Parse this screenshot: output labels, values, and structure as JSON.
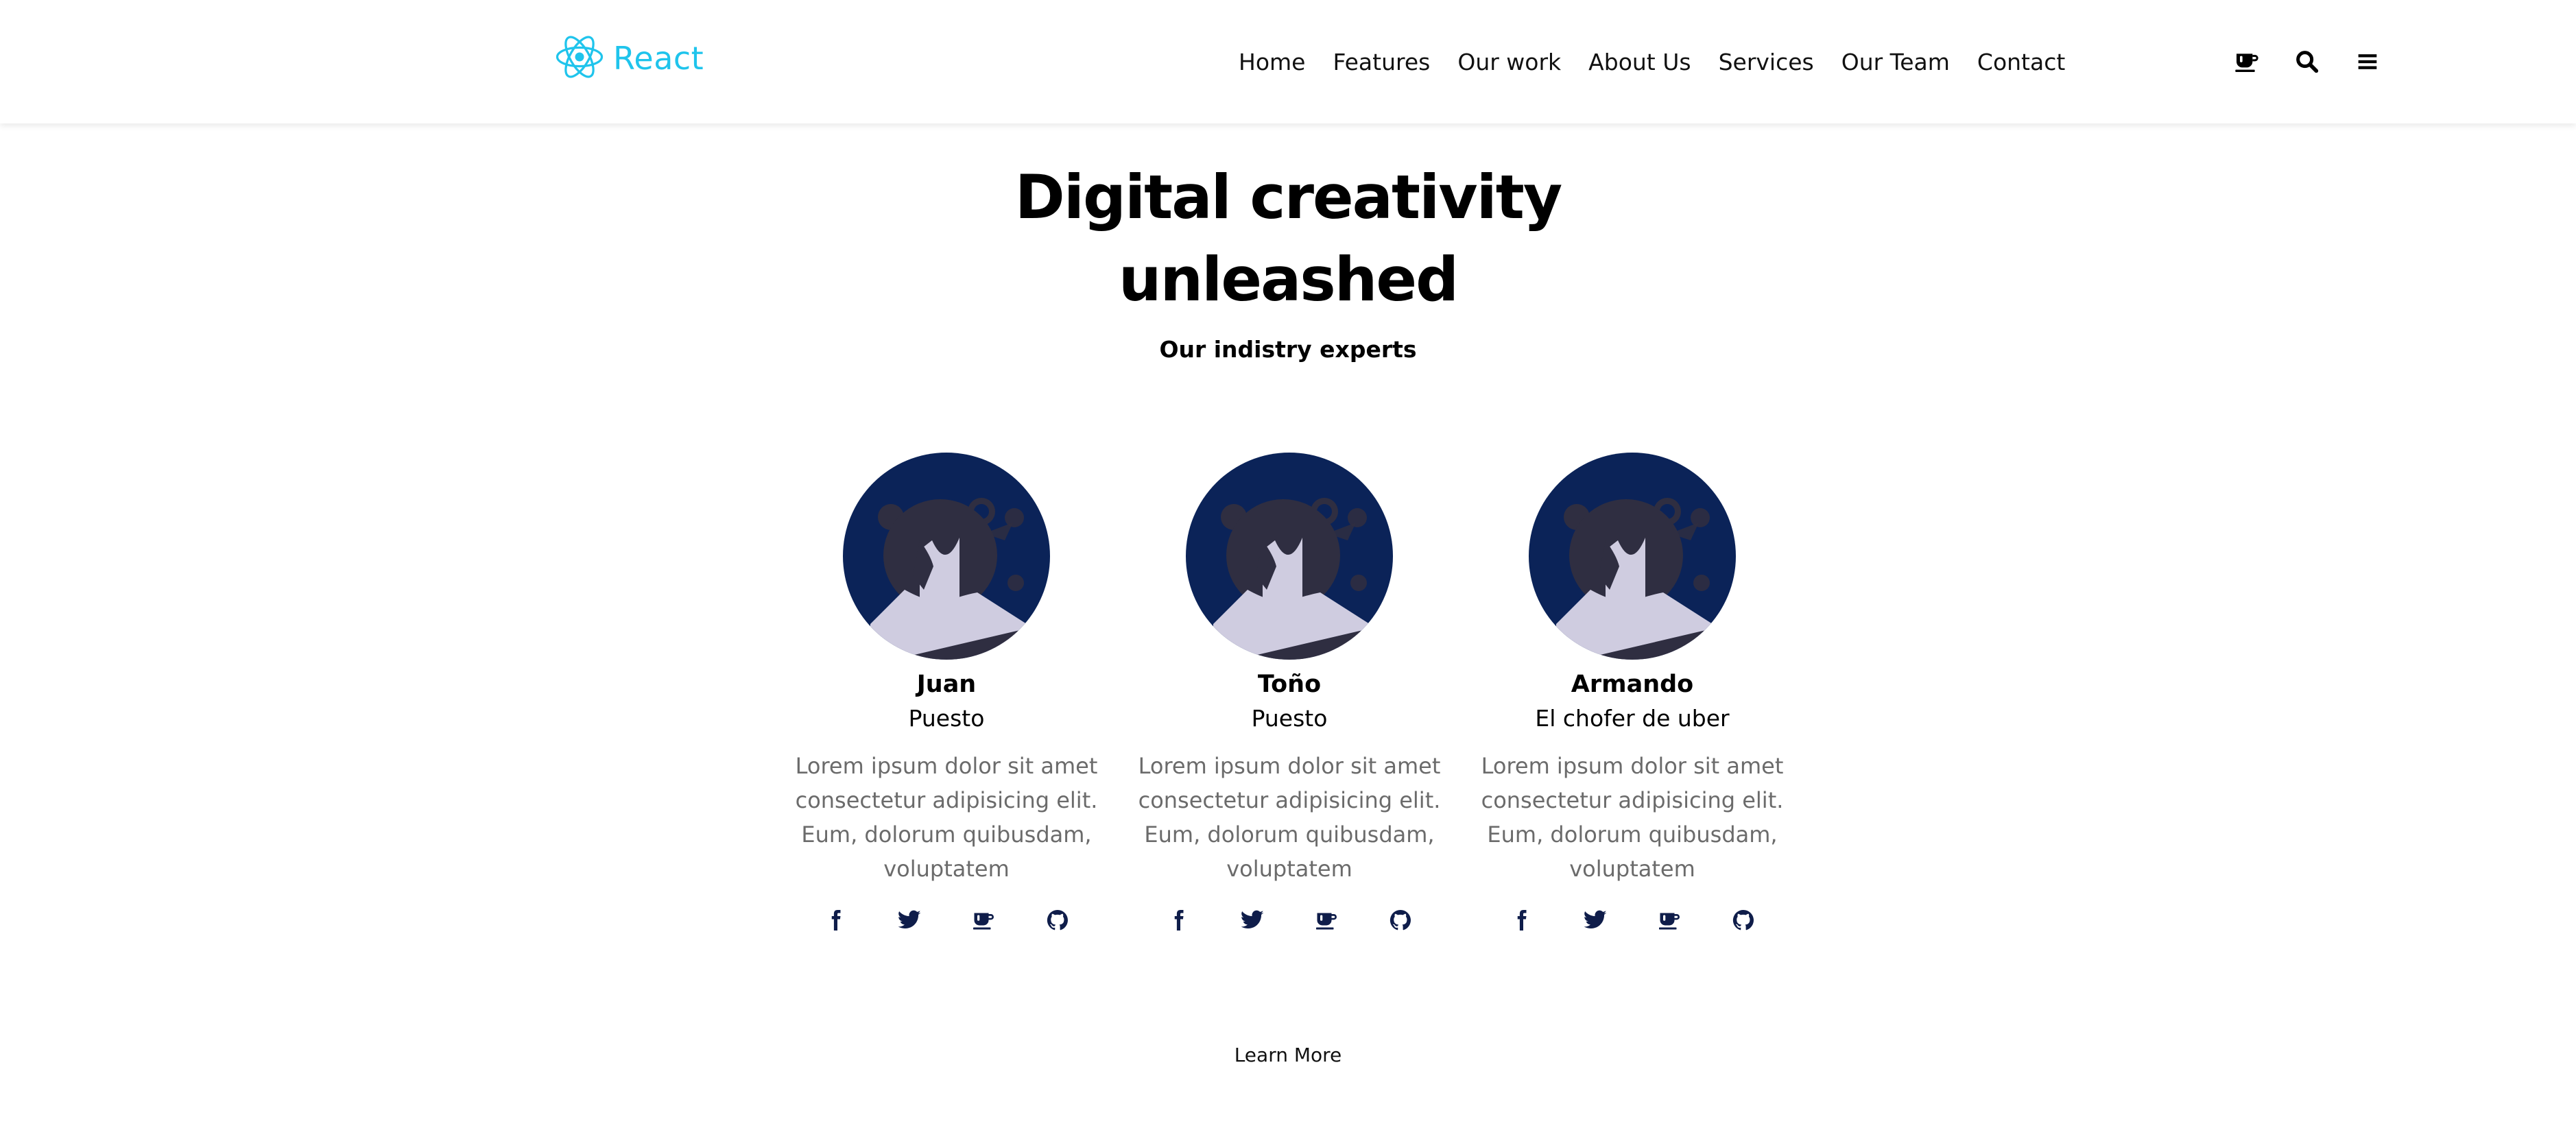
{
  "brand": {
    "name": "React",
    "color": "#1fc4ec",
    "icon": "react-logo-icon"
  },
  "nav": {
    "items": [
      "Home",
      "Features",
      "Our work",
      "About Us",
      "Services",
      "Our Team",
      "Contact"
    ]
  },
  "toolbar": {
    "icons": [
      "coffee-icon",
      "search-icon",
      "menu-icon"
    ]
  },
  "hero": {
    "title_line1": "Digital creativity",
    "title_line2": "unleashed",
    "subtitle": "Our indistry experts"
  },
  "team": [
    {
      "name": "Juan",
      "role": "Puesto",
      "bio": "Lorem ipsum dolor sit amet consectetur adipisicing elit. Eum, dolorum quibusdam, voluptatem",
      "socials": [
        "facebook-icon",
        "twitter-icon",
        "coffee-icon",
        "github-icon"
      ]
    },
    {
      "name": "Toño",
      "role": "Puesto",
      "bio": "Lorem ipsum dolor sit amet consectetur adipisicing elit. Eum, dolorum quibusdam, voluptatem",
      "socials": [
        "facebook-icon",
        "twitter-icon",
        "coffee-icon",
        "github-icon"
      ]
    },
    {
      "name": "Armando",
      "role": "El chofer de uber",
      "bio": "Lorem ipsum dolor sit amet consectetur adipisicing elit. Eum, dolorum quibusdam, voluptatem",
      "socials": [
        "facebook-icon",
        "twitter-icon",
        "coffee-icon",
        "github-icon"
      ]
    }
  ],
  "cta": {
    "label": "Learn More"
  },
  "colors": {
    "avatar_bg": "#0b2358",
    "hair": "#2f2e41",
    "skin": "#cfcce0",
    "social_icon": "#0f1d4a"
  }
}
